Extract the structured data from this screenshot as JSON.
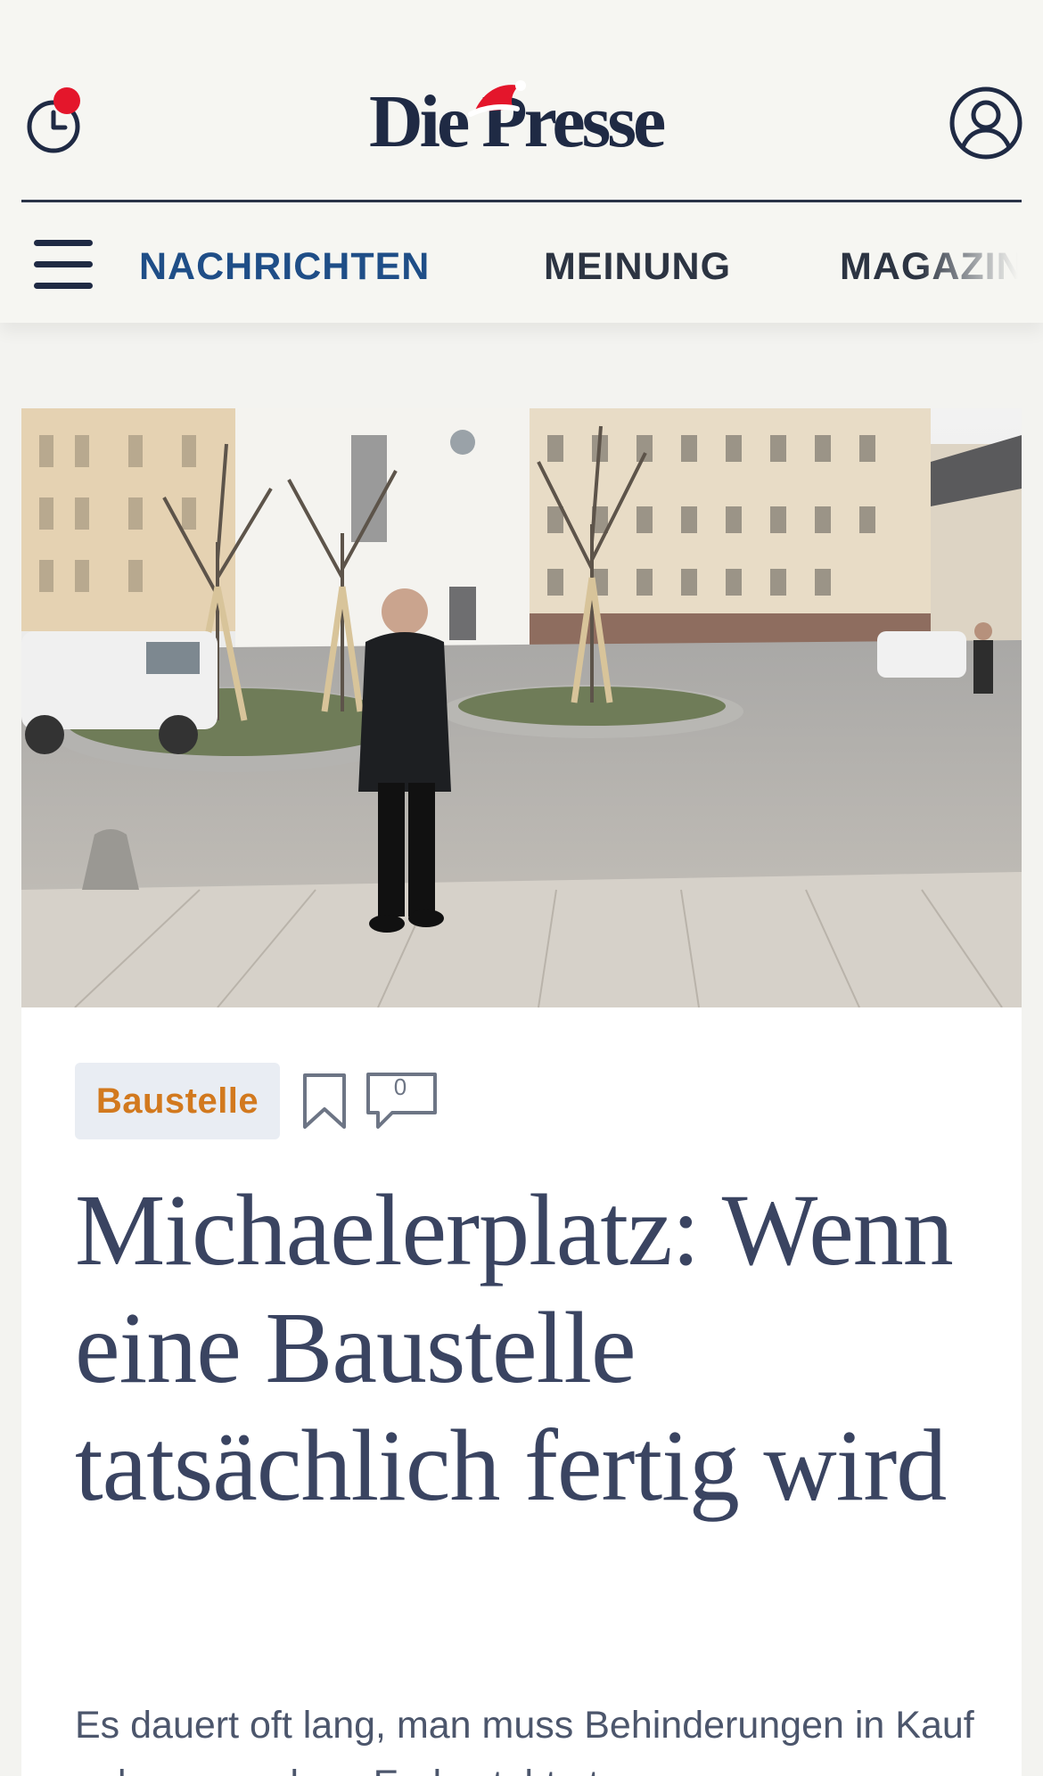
{
  "header": {
    "logo_text": "Die Presse",
    "history_icon": "history-clock-icon",
    "notification_indicator": "red-dot",
    "account_icon": "user-account-icon",
    "colors": {
      "brand": "#1f2a44",
      "notification": "#e4162b",
      "active_tab": "#1f4e87"
    }
  },
  "nav": {
    "menu_icon": "hamburger-menu-icon",
    "tabs": [
      {
        "label": "NACHRICHTEN",
        "active": true
      },
      {
        "label": "MEINUNG",
        "active": false
      },
      {
        "label": "MAGAZIN",
        "active": false
      }
    ]
  },
  "article": {
    "tag": "Baustelle",
    "tag_color": "#d2791e",
    "bookmark_icon": "bookmark-icon",
    "comment_icon": "comment-bubble-icon",
    "comment_count": "0",
    "headline": "Michaelerplatz: Wenn eine Baustelle tatsächlich fertig wird",
    "lead": "Es dauert oft lang, man muss Behinderungen in Kauf nehmen, und am Ende steht etwas"
  }
}
